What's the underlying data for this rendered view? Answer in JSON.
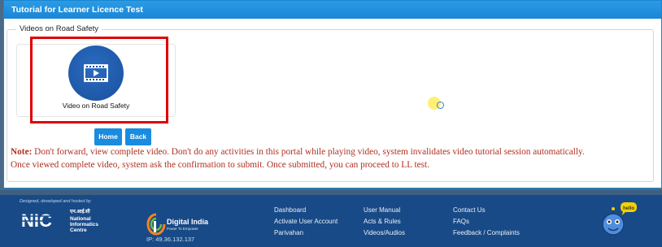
{
  "panel": {
    "title": "Tutorial for Learner Licence Test"
  },
  "section": {
    "legend": "Videos on Road Safety"
  },
  "video_card": {
    "label": "Video on Road Safety",
    "icon": "video-play-icon"
  },
  "buttons": {
    "home": "Home",
    "back": "Back"
  },
  "note": {
    "prefix": "Note:",
    "line1": " Don't forward, view complete video. Don't do any activities in this portal while playing video, system invalidates video tutorial session automatically.",
    "line2": "Once viewed complete video, system ask the confirmation to submit. Once submitted, you can proceed to LL test."
  },
  "footer": {
    "credit": "Designed, developed and hosted by",
    "nic_hindi": "एन.आई.सी",
    "nic_line1": "National",
    "nic_line2": "Informatics",
    "nic_line3": "Centre",
    "digital_india": "Digital India",
    "digital_india_sub": "Power To Empower",
    "ip": "IP: 49.36.132.137",
    "col1": [
      "Dashboard",
      "Activate User Account",
      "Parivahan"
    ],
    "col2": [
      "User Manual",
      "Acts & Rules",
      "Videos/Audios"
    ],
    "col3": [
      "Contact Us",
      "FAQs",
      "Feedback / Complaints"
    ],
    "mascot_bubble": "hello"
  },
  "colors": {
    "accent": "#1a86d6",
    "note_red": "#b03020",
    "footer_blue": "#184a87",
    "highlight": "#e00000"
  }
}
